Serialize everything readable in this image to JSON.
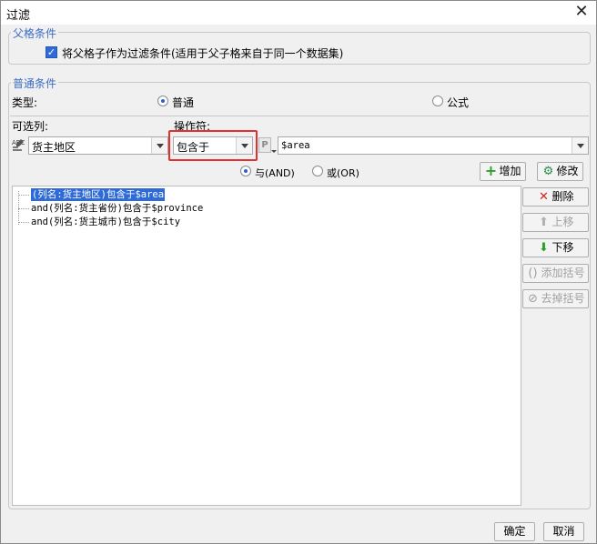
{
  "window": {
    "title": "过滤",
    "close_glyph": "✕"
  },
  "parent_condition": {
    "legend": "父格条件",
    "checkbox_label": "将父格子作为过滤条件(适用于父子格来自于同一个数据集)",
    "checked": true
  },
  "normal_condition": {
    "legend": "普通条件",
    "type_label": "类型:",
    "type_options": [
      {
        "label": "普通",
        "selected": true
      },
      {
        "label": "公式",
        "selected": false
      }
    ],
    "column_label": "可选列:",
    "operator_label": "操作符:",
    "column_value": "货主地区",
    "operator_value": "包含于",
    "param_badge": "P",
    "value_field": "$area",
    "logic_options": [
      {
        "label": "与(AND)",
        "selected": true
      },
      {
        "label": "或(OR)",
        "selected": false
      }
    ],
    "add_button": "增加",
    "modify_button": "修改"
  },
  "conditions": [
    {
      "text": "(列名:货主地区)包含于$area",
      "selected": true
    },
    {
      "text": "and(列名:货主省份)包含于$province",
      "selected": false
    },
    {
      "text": "and(列名:货主城市)包含于$city",
      "selected": false
    }
  ],
  "side_buttons": {
    "delete": "删除",
    "move_up": "上移",
    "move_down": "下移",
    "add_bracket": "添加括号",
    "remove_bracket": "去掉括号"
  },
  "footer": {
    "ok": "确定",
    "cancel": "取消"
  },
  "colors": {
    "accent": "#3b6cc4",
    "highlight_border": "#e03030",
    "selection": "#2f6bd8"
  }
}
